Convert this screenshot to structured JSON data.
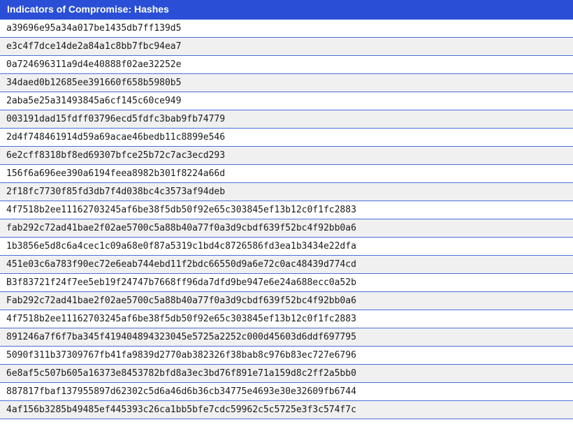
{
  "table": {
    "title": "Indicators of Compromise: Hashes",
    "rows": [
      "a39696e95a34a017be1435db7ff139d5",
      "e3c4f7dce14de2a84a1c8bb7fbc94ea7",
      "0a724696311a9d4e40888f02ae32252e",
      "34daed0b12685ee391660f658b5980b5",
      "2aba5e25a31493845a6cf145c60ce949",
      "003191dad15fdff03796ecd5fdfc3bab9fb74779",
      "2d4f748461914d59a69acae46bedb11c8899e546",
      "6e2cff8318bf8ed69307bfce25b72c7ac3ecd293",
      "156f6a696ee390a6194feea8982b301f8224a66d",
      "2f18fc7730f85fd3db7f4d038bc4c3573af94deb",
      "4f7518b2ee11162703245af6be38f5db50f92e65c303845ef13b12c0f1fc2883",
      "fab292c72ad41bae2f02ae5700c5a88b40a77f0a3d9cbdf639f52bc4f92bb0a6",
      "1b3856e5d8c6a4cec1c09a68e0f87a5319c1bd4c8726586fd3ea1b3434e22dfa",
      "451e03c6a783f90ec72e6eab744ebd11f2bdc66550d9a6e72c0ac48439d774cd",
      "B3f83721f24f7ee5eb19f24747b7668ff96da7dfd9be947e6e24a688ecc0a52b",
      "Fab292c72ad41bae2f02ae5700c5a88b40a77f0a3d9cbdf639f52bc4f92bb0a6",
      "4f7518b2ee11162703245af6be38f5db50f92e65c303845ef13b12c0f1fc2883",
      "891246a7f6f7ba345f419404894323045e5725a2252c000d45603d6ddf697795",
      "5090f311b37309767fb41fa9839d2770ab382326f38bab8c976b83ec727e6796",
      "6e8af5c507b605a16373e8453782bfd8a3ec3bd76f891e71a159d8c2ff2a5bb0",
      "887817fbaf137955897d62302c5d6a46d6b36cb34775e4693e30e32609fb6744",
      "4af156b3285b49485ef445393c26ca1bb5bfe7cdc59962c5c5725e3f3c574f7c"
    ]
  }
}
